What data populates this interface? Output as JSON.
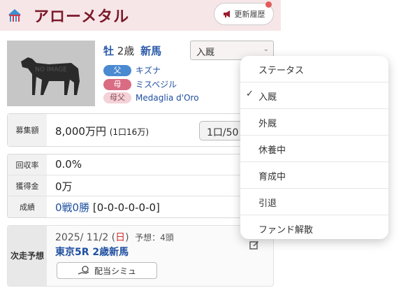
{
  "header": {
    "title": "アローメタル",
    "history_label": "更新履歴"
  },
  "photo": {
    "placeholder": "NO IMAGE"
  },
  "horse": {
    "sex": "牡",
    "age": "2歳",
    "class": "新馬"
  },
  "status_select": {
    "value": "入厩",
    "caret": "⌄"
  },
  "pedigree": [
    {
      "tag": "父",
      "name": "キズナ"
    },
    {
      "tag": "母",
      "name": "ミスベジル"
    },
    {
      "tag": "母父",
      "name": "Medaglia d'Oro"
    }
  ],
  "recruit": {
    "label": "募集額",
    "value": "8,000万円",
    "sub": "(1口16万)",
    "unit_button": "1口/50"
  },
  "stats": [
    {
      "label": "回収率",
      "value": "0.0%"
    },
    {
      "label": "獲得金",
      "value": "0万"
    },
    {
      "label": "成績",
      "wins": "0戦0勝",
      "record": "[0-0-0-0-0-0]"
    }
  ],
  "next_race": {
    "label_line1": "次走",
    "label_line2": "予想",
    "date": "2025/ 11/2 (",
    "day": "日",
    "date_close": ")",
    "prediction": "予想：4頭",
    "race_name": "東京5R 2歳新馬",
    "sim_button": "配当シミュ"
  },
  "menu": {
    "check_mark": "✓",
    "items": [
      "ステータス",
      "入厩",
      "外厩",
      "休養中",
      "育成中",
      "引退",
      "ファンド解散"
    ],
    "selected": "入厩"
  },
  "colors": {
    "accent": "#7a1a2a",
    "link": "#1f4fa0",
    "header_bg": "#f7e6e8"
  }
}
